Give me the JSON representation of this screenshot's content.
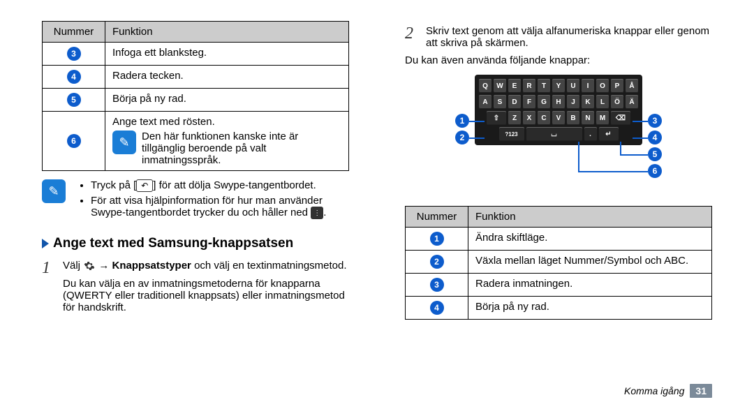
{
  "left": {
    "table_head": {
      "col1": "Nummer",
      "col2": "Funktion"
    },
    "rows": [
      {
        "n": "3",
        "f": "Infoga ett blanksteg."
      },
      {
        "n": "4",
        "f": "Radera tecken."
      },
      {
        "n": "5",
        "f": "Börja på ny rad."
      },
      {
        "n": "6",
        "f_top": "Ange text med rösten.",
        "f_note": "Den här funktionen kanske inte är tillgänglig beroende på valt inmatningsspråk."
      }
    ],
    "note": {
      "b1_pre": "Tryck på [",
      "b1_post": "] för att dölja Swype-tangentbordet.",
      "b2_pre": "För att visa hjälpinformation för hur man använder Swype-tangentbordet trycker du och håller ned ",
      "b2_post": "."
    },
    "heading": "Ange text med Samsung-knappsatsen",
    "step1": {
      "pre": "Välj ",
      "mid": " → ",
      "bold": "Knappsatstyper",
      "post": " och välj en textinmatningsmetod."
    },
    "step1_sub": "Du kan välja en av inmatningsmetoderna för knapparna (QWERTY eller traditionell knappsats) eller inmatningsmetod för handskrift."
  },
  "right": {
    "step2": "Skriv text genom att välja alfanumeriska knappar eller genom att skriva på skärmen.",
    "sub": "Du kan även använda följande knappar:",
    "keys": {
      "r1": [
        "Q",
        "W",
        "E",
        "R",
        "T",
        "Y",
        "U",
        "I",
        "O",
        "P",
        "Å"
      ],
      "r2": [
        "A",
        "S",
        "D",
        "F",
        "G",
        "H",
        "J",
        "K",
        "L",
        "Ö",
        "Ä"
      ],
      "r3_shift": "⇧",
      "r3_mid": [
        "Z",
        "X",
        "C",
        "V",
        "B",
        "N",
        "M"
      ],
      "r3_bksp": "⌫",
      "r4_mode": "?123",
      "r4_space": "⌴",
      "r4_dot": ".",
      "r4_enter": "↵"
    },
    "callouts": {
      "c1": "1",
      "c2": "2",
      "c3": "3",
      "c4": "4",
      "c5": "5",
      "c6": "6"
    },
    "table_head": {
      "col1": "Nummer",
      "col2": "Funktion"
    },
    "rows": [
      {
        "n": "1",
        "f": "Ändra skiftläge."
      },
      {
        "n": "2",
        "f": "Växla mellan läget Nummer/Symbol och ABC."
      },
      {
        "n": "3",
        "f": "Radera inmatningen."
      },
      {
        "n": "4",
        "f": "Börja på ny rad."
      }
    ]
  },
  "footer": {
    "section": "Komma igång",
    "page": "31"
  }
}
